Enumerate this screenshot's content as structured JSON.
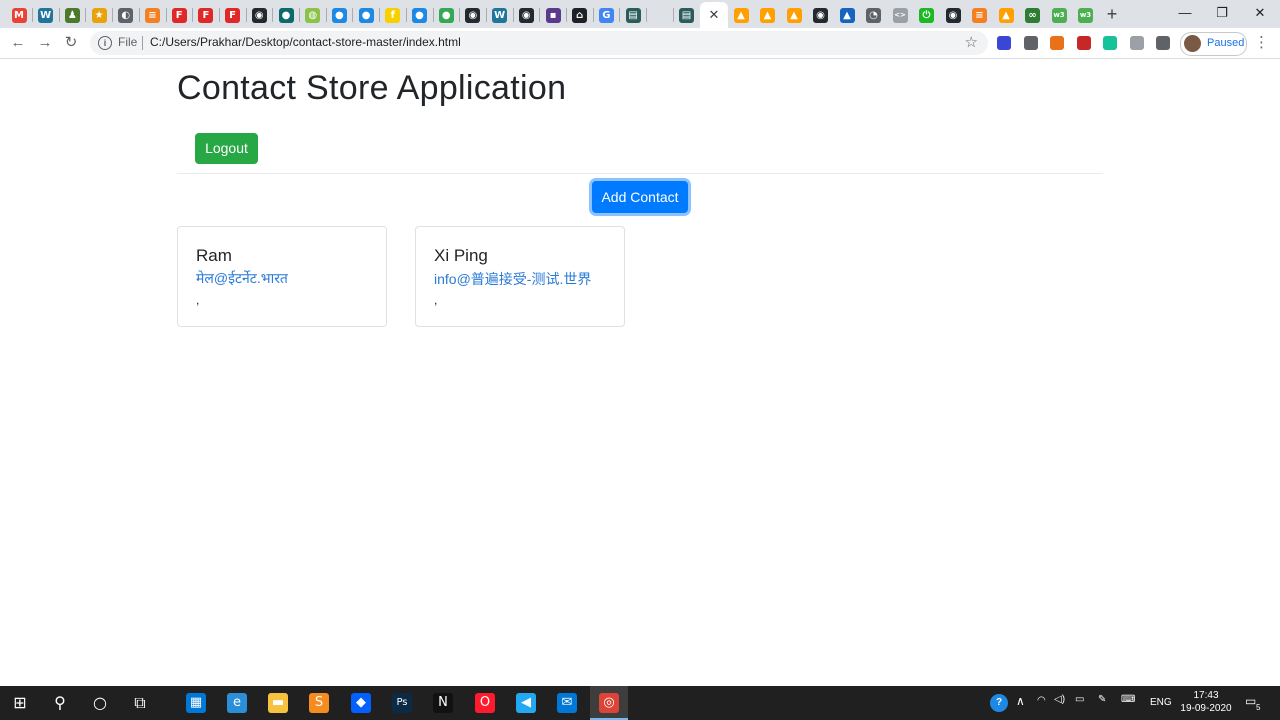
{
  "browser": {
    "tabs": [
      {
        "icon": "gmail-icon",
        "color": "#ea4335",
        "glyph": "M"
      },
      {
        "icon": "wordpress-icon",
        "color": "#21759b",
        "glyph": "W"
      },
      {
        "icon": "chess-icon",
        "color": "#4a7a2c",
        "glyph": "♟"
      },
      {
        "icon": "bookmark-star-icon",
        "color": "#e8a20c",
        "glyph": "★"
      },
      {
        "icon": "globe-icon",
        "color": "#5f6368",
        "glyph": "◐"
      },
      {
        "icon": "stackoverflow-icon",
        "color": "#f48024",
        "glyph": "≡"
      },
      {
        "icon": "flipboard-icon",
        "color": "#e12828",
        "glyph": "F"
      },
      {
        "icon": "flipboard-icon",
        "color": "#e12828",
        "glyph": "F"
      },
      {
        "icon": "flipboard-icon",
        "color": "#e12828",
        "glyph": "F"
      },
      {
        "icon": "github-icon",
        "color": "#24292e",
        "glyph": "◉"
      },
      {
        "icon": "codechef-icon",
        "color": "#0b6b6b",
        "glyph": "●"
      },
      {
        "icon": "leaf-icon",
        "color": "#8bc34a",
        "glyph": "◍"
      },
      {
        "icon": "info-circle-icon",
        "color": "#1e88e5",
        "glyph": "●"
      },
      {
        "icon": "info-circle-icon",
        "color": "#1e88e5",
        "glyph": "●"
      },
      {
        "icon": "flipkart-icon",
        "color": "#f7d000",
        "glyph": "f"
      },
      {
        "icon": "info-circle-icon",
        "color": "#1e88e5",
        "glyph": "●"
      },
      {
        "icon": "sheets-icon",
        "color": "#34a853",
        "glyph": "●"
      },
      {
        "icon": "github-icon",
        "color": "#24292e",
        "glyph": "◉"
      },
      {
        "icon": "wordpress-icon",
        "color": "#21759b",
        "glyph": "W"
      },
      {
        "icon": "github-icon",
        "color": "#24292e",
        "glyph": "◉"
      },
      {
        "icon": "hackerrank-icon",
        "color": "#5b3a8c",
        "glyph": "▪"
      },
      {
        "icon": "home-icon",
        "color": "#202124",
        "glyph": "⌂"
      },
      {
        "icon": "google-icon",
        "color": "#4285f4",
        "glyph": "G"
      },
      {
        "icon": "tutorial-icon",
        "color": "#2b5c5c",
        "glyph": "▤"
      },
      {
        "icon": "blank-tab-icon",
        "color": "#dee1e6",
        "glyph": ""
      },
      {
        "icon": "tutorial-icon",
        "color": "#2b5c5c",
        "glyph": "▤"
      }
    ],
    "tabs_right": [
      {
        "icon": "firebase-icon",
        "color": "#ffa000",
        "glyph": "▲"
      },
      {
        "icon": "firebase-icon",
        "color": "#ffa000",
        "glyph": "▲"
      },
      {
        "icon": "firebase-icon",
        "color": "#ffa000",
        "glyph": "▲"
      },
      {
        "icon": "github-icon",
        "color": "#24292e",
        "glyph": "◉"
      },
      {
        "icon": "graduation-cap-icon",
        "color": "#1565c0",
        "glyph": "▲"
      },
      {
        "icon": "owl-icon",
        "color": "#5f6368",
        "glyph": "◔"
      },
      {
        "icon": "code-brackets-icon",
        "color": "#9aa0a6",
        "glyph": "<>"
      },
      {
        "icon": "power-icon",
        "color": "#1db924",
        "glyph": "⏻"
      },
      {
        "icon": "github-icon",
        "color": "#24292e",
        "glyph": "◉"
      },
      {
        "icon": "stackoverflow-icon",
        "color": "#f48024",
        "glyph": "≡"
      },
      {
        "icon": "firebase-icon",
        "color": "#ffa000",
        "glyph": "▲"
      },
      {
        "icon": "infinity-icon",
        "color": "#2e7d32",
        "glyph": "∞"
      },
      {
        "icon": "w3-icon",
        "color": "#4caf50",
        "glyph": "w3"
      },
      {
        "icon": "w3-icon",
        "color": "#4caf50",
        "glyph": "w3"
      }
    ],
    "active_tab_close": "✕",
    "new_tab": "+",
    "window_controls": {
      "minimize": "—",
      "maximize": "❐",
      "close": "✕"
    },
    "nav": {
      "back": "←",
      "forward": "→",
      "reload": "↻"
    },
    "address": {
      "scheme_label": "File",
      "url": "C:/Users/Prakhar/Desktop/contact-store-master/index.html",
      "bookmark_icon": "☆"
    },
    "extensions": [
      {
        "icon": "bars-ext-icon",
        "color": "#3a47d5"
      },
      {
        "icon": "shield-ext-icon",
        "color": "#5f6368"
      },
      {
        "icon": "go-ext-icon",
        "color": "#e8711a"
      },
      {
        "icon": "record-ext-icon",
        "color": "#c62828"
      },
      {
        "icon": "grammarly-icon",
        "color": "#15c39a"
      },
      {
        "icon": "lock-ext-icon",
        "color": "#9aa0a6"
      },
      {
        "icon": "puzzle-icon",
        "color": "#5f6368"
      }
    ],
    "profile": {
      "label": "Paused"
    },
    "menu": "⋮"
  },
  "page": {
    "title": "Contact Store Application",
    "logout_label": "Logout",
    "add_contact_label": "Add Contact",
    "contacts": [
      {
        "name": "Ram",
        "email": "मेल@ईटर्नेट.भारत",
        "address": ","
      },
      {
        "name": "Xi Ping",
        "email": "info@普遍接受-测试.世界",
        "address": ","
      }
    ]
  },
  "taskbar": {
    "apps": [
      {
        "icon": "windows-start-icon",
        "color": "#ffffff",
        "glyph": "⊞"
      },
      {
        "icon": "search-icon",
        "color": "#ffffff",
        "glyph": "⚲"
      },
      {
        "icon": "cortana-icon",
        "color": "#ffffff",
        "glyph": "○"
      },
      {
        "icon": "task-view-icon",
        "color": "#ffffff",
        "glyph": "⧉"
      },
      {
        "icon": "store-icon",
        "color": "#0078d7",
        "glyph": "▦"
      },
      {
        "icon": "edge-icon",
        "color": "#2a8fd8",
        "glyph": "e"
      },
      {
        "icon": "file-explorer-icon",
        "color": "#f8c240",
        "glyph": "▬"
      },
      {
        "icon": "sublime-icon",
        "color": "#f68b1f",
        "glyph": "S"
      },
      {
        "icon": "dropbox-icon",
        "color": "#0061fe",
        "glyph": "◆"
      },
      {
        "icon": "photoshop-icon",
        "color": "#0a2a45",
        "glyph": "Ps"
      },
      {
        "icon": "netflix-icon",
        "color": "#111111",
        "glyph": "N"
      },
      {
        "icon": "opera-icon",
        "color": "#ff1b2d",
        "glyph": "O"
      },
      {
        "icon": "vscode-icon",
        "color": "#23a9f2",
        "glyph": "◀"
      },
      {
        "icon": "mail-icon",
        "color": "#0078d7",
        "glyph": "✉"
      },
      {
        "icon": "chrome-icon",
        "color": "#db4437",
        "glyph": "◎"
      }
    ],
    "tray": {
      "help_icon": "?",
      "chevron": "∧",
      "language": "ENG",
      "time": "17:43",
      "date": "19-09-2020",
      "notifications": "5"
    }
  }
}
